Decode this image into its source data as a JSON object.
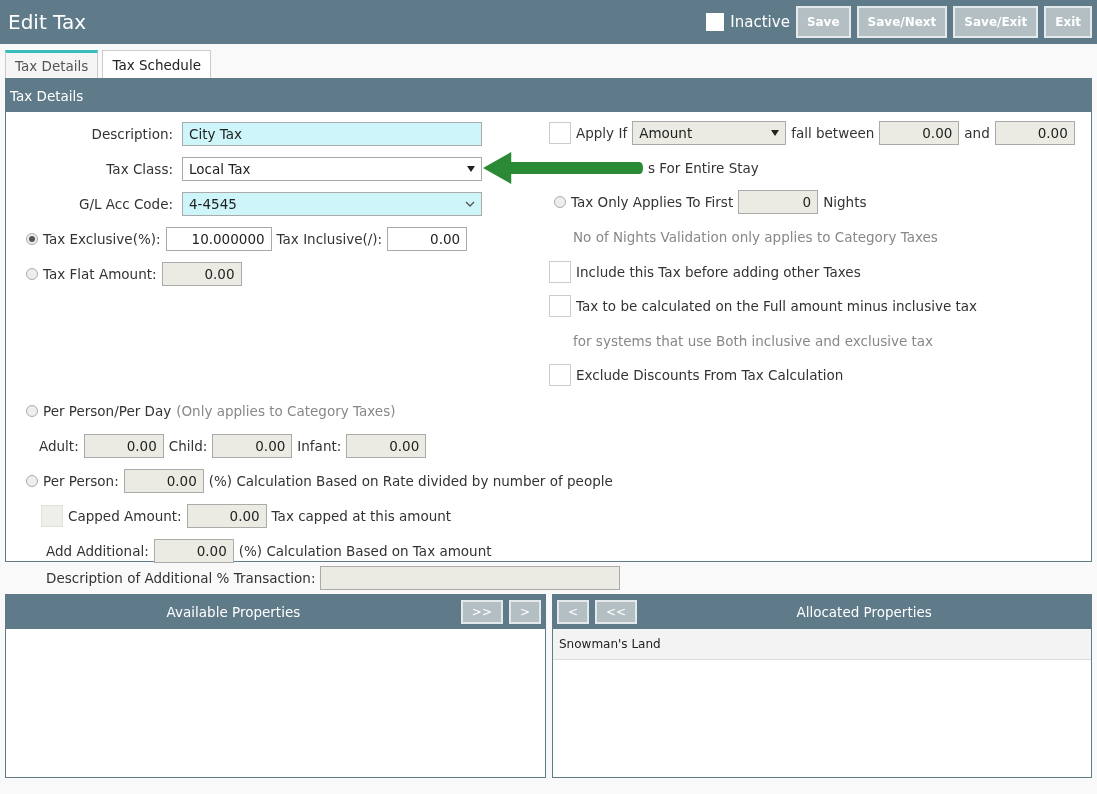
{
  "header": {
    "title": "Edit Tax",
    "inactive": {
      "label": "Inactive",
      "checked": false
    },
    "buttons": [
      "Save",
      "Save/Next",
      "Save/Exit",
      "Exit"
    ]
  },
  "tabs": [
    {
      "label": "Tax Details",
      "selected": true
    },
    {
      "label": "Tax Schedule",
      "selected": false
    }
  ],
  "section_title": "Tax Details",
  "description": {
    "label": "Description:",
    "value": "City Tax",
    "highlighted": true
  },
  "tax_class": {
    "label": "Tax Class:",
    "value": "Local Tax"
  },
  "gl_code": {
    "label": "G/L Acc Code:",
    "value": "4-4545",
    "highlighted": true
  },
  "tax_exclusive": {
    "label": "Tax Exclusive(%):",
    "value": "10.000000",
    "selected": true
  },
  "tax_inclusive": {
    "label": "Tax Inclusive(/):",
    "value": "0.00"
  },
  "tax_flat": {
    "label": "Tax Flat Amount:",
    "value": "0.00",
    "selected": false,
    "disabled": true
  },
  "apply_if": {
    "checked": false,
    "label": "Apply If",
    "select": "Amount",
    "between_label": "fall between",
    "from": "0.00",
    "and_label": "and",
    "to": "0.00"
  },
  "entire_stay": {
    "label": "s For Entire Stay"
  },
  "first_nights": {
    "selected": false,
    "label": "Tax Only Applies To First",
    "value": "0",
    "unit": "Nights"
  },
  "options": [
    {
      "kind": "note",
      "label": "No of Nights Validation only applies to Category Taxes"
    },
    {
      "kind": "checkbox",
      "label": "Include this Tax before adding other Taxes",
      "checked": false
    },
    {
      "kind": "checkbox",
      "label": "Tax to be calculated on the Full amount minus inclusive tax",
      "checked": false
    },
    {
      "kind": "note",
      "label": "for systems that use Both inclusive and exclusive tax"
    },
    {
      "kind": "checkbox",
      "label": "Exclude Discounts From Tax Calculation",
      "checked": false
    }
  ],
  "per_person_day": {
    "selected": false,
    "label": "Per Person/Per Day",
    "note": "(Only applies to Category Taxes)"
  },
  "guests": [
    {
      "label": "Adult:",
      "value": "0.00"
    },
    {
      "label": "Child:",
      "value": "0.00"
    },
    {
      "label": "Infant:",
      "value": "0.00"
    }
  ],
  "per_person": {
    "selected": false,
    "label": "Per Person:",
    "value": "0.00",
    "note": "(%) Calculation Based on Rate divided by number of people"
  },
  "capped": {
    "checked": false,
    "disabled": true,
    "label": "Capped Amount:",
    "value": "0.00",
    "note": "Tax capped at this amount"
  },
  "add_additional": {
    "label": "Add Additional:",
    "value": "0.00",
    "note": "(%) Calculation Based on Tax amount"
  },
  "additional_description": {
    "label": "Description of Additional % Transaction:"
  },
  "available": {
    "title": "Available Properties",
    "buttons": [
      ">>",
      ">"
    ]
  },
  "allocated": {
    "title": "Allocated Properties",
    "buttons": [
      "<",
      "<<"
    ],
    "items": [
      "Snowman's Land"
    ]
  }
}
